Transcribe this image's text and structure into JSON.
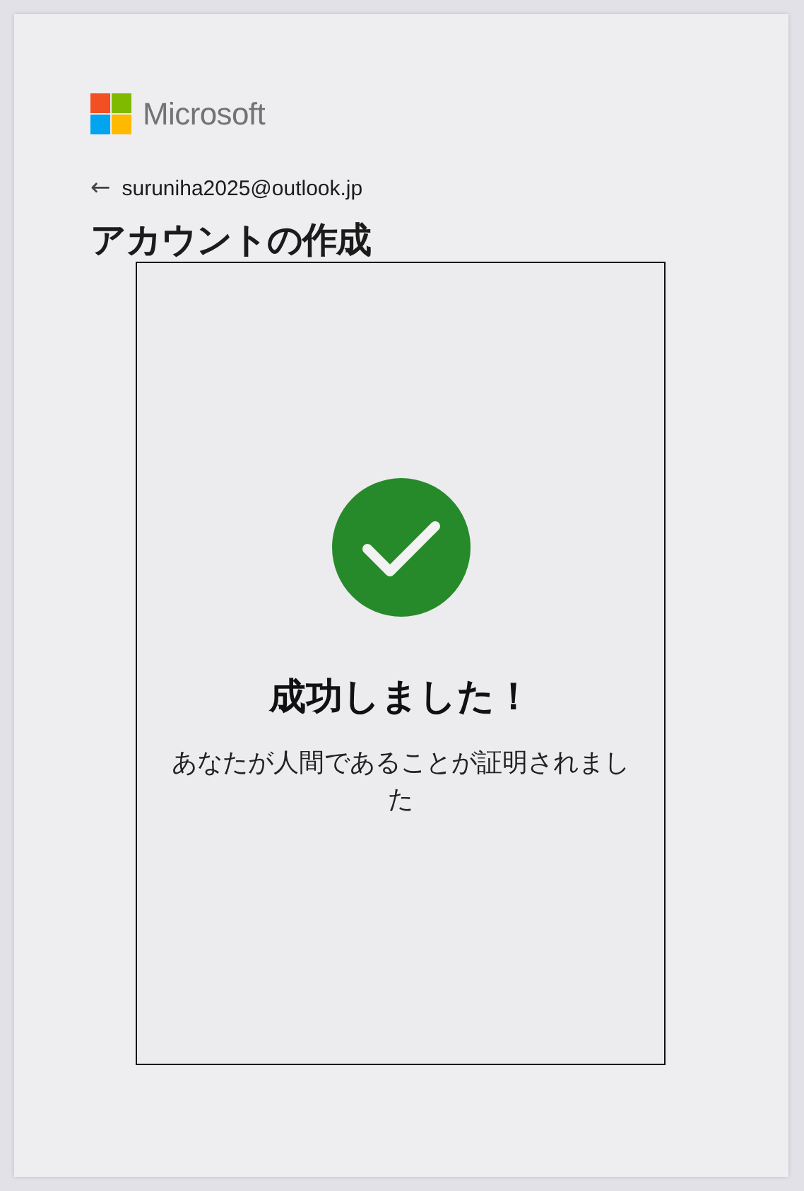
{
  "logo": {
    "text": "Microsoft"
  },
  "account": {
    "back": "←",
    "email": "suruniha2025@outlook.jp"
  },
  "title": "アカウントの作成",
  "result": {
    "heading": "成功しました！",
    "message": "あなたが人間であることが証明されました"
  }
}
